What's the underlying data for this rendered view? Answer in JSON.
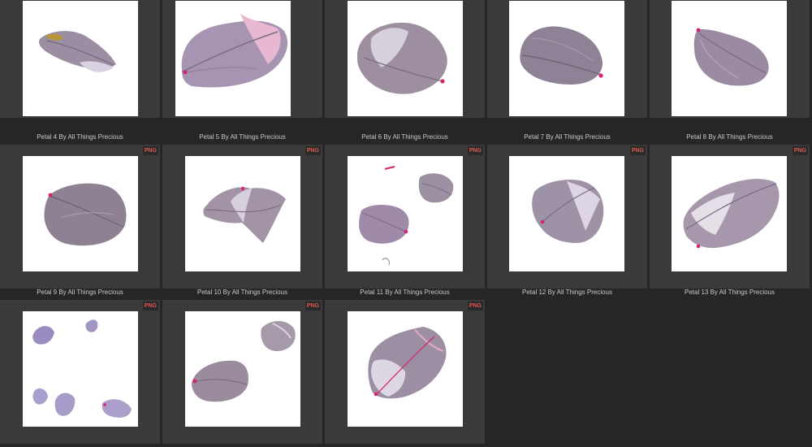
{
  "badge_text": "PNG",
  "items": [
    {
      "label": "Petal 4 By All Things Precious",
      "badge": false
    },
    {
      "label": "Petal 5 By All Things Precious",
      "badge": false
    },
    {
      "label": "Petal 6 By All Things Precious",
      "badge": false
    },
    {
      "label": "Petal 7 By All Things Precious",
      "badge": false
    },
    {
      "label": "Petal 8 By All Things Precious",
      "badge": false
    },
    {
      "label": "Petal 9 By All Things Precious",
      "badge": true
    },
    {
      "label": "Petal 10 By All Things Precious",
      "badge": true
    },
    {
      "label": "Petal 11 By All Things Precious",
      "badge": true
    },
    {
      "label": "Petal 12 By All Things Precious",
      "badge": true
    },
    {
      "label": "Petal 13 By All Things Precious",
      "badge": true
    },
    {
      "label": "",
      "badge": true
    },
    {
      "label": "",
      "badge": true
    },
    {
      "label": "",
      "badge": true
    }
  ],
  "colors": {
    "background": "#262626",
    "cell": "#3a3a3a",
    "label": "#c8c8c8",
    "badge": "#e2574c",
    "petal": "#8f7f94",
    "petal_light": "#c7bccd",
    "petal_tip": "#d6246d"
  }
}
